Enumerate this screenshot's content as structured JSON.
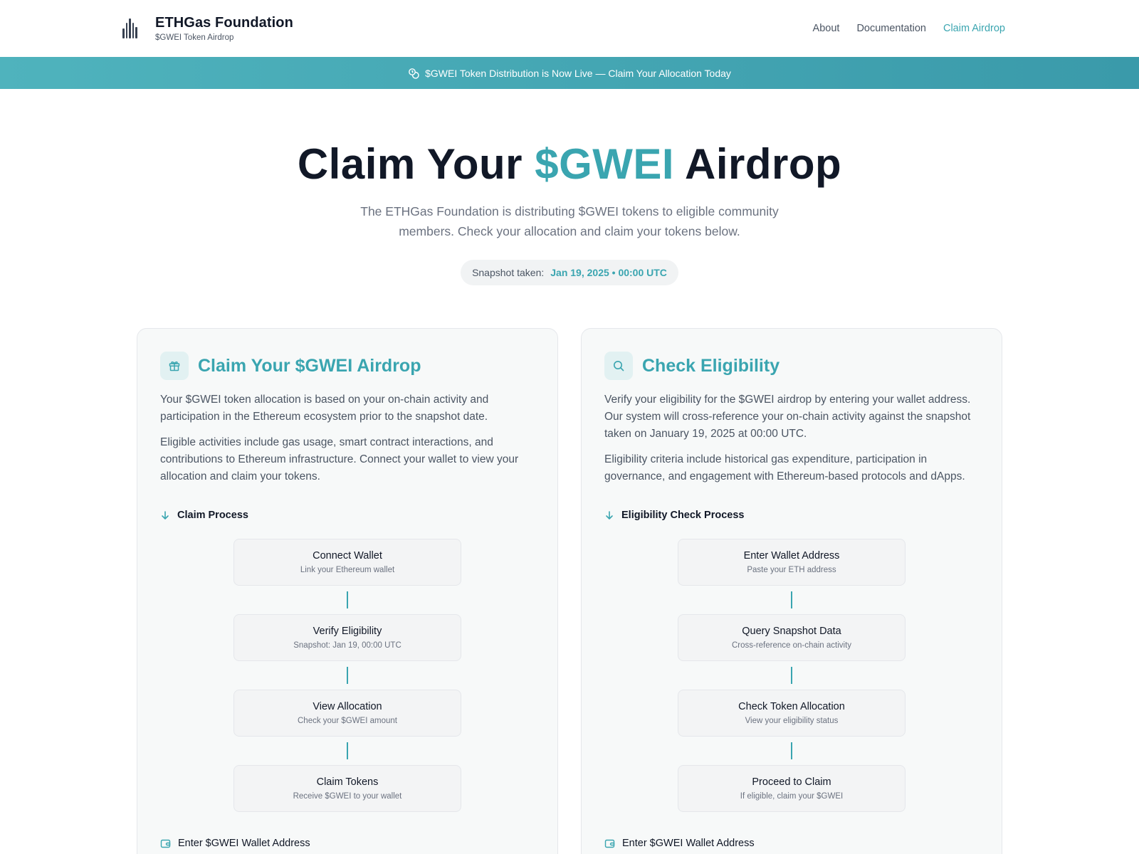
{
  "header": {
    "brand_title": "ETHGas Foundation",
    "brand_subtitle": "$GWEI Token Airdrop",
    "nav": [
      {
        "label": "About"
      },
      {
        "label": "Documentation"
      },
      {
        "label": "Claim Airdrop"
      }
    ]
  },
  "banner": {
    "text": "$GWEI Token Distribution is Now Live — Claim Your Allocation Today"
  },
  "hero": {
    "title_start": "Claim Your ",
    "title_accent": "$GWEI",
    "title_end": " Airdrop",
    "description": "The ETHGas Foundation is distributing $GWEI tokens to eligible community members. Check your allocation and claim your tokens below.",
    "snapshot_label": "Snapshot taken:",
    "snapshot_value": "Jan 19, 2025 • 00:00 UTC"
  },
  "claim_card": {
    "title": "Claim Your $GWEI Airdrop",
    "paragraph_1": "Your $GWEI token allocation is based on your on-chain activity and participation in the Ethereum ecosystem prior to the snapshot date.",
    "paragraph_2": "Eligible activities include gas usage, smart contract interactions, and contributions to Ethereum infrastructure. Connect your wallet to view your allocation and claim your tokens.",
    "process_label": "Claim Process",
    "steps": [
      {
        "title": "Connect Wallet",
        "subtitle": "Link your Ethereum wallet"
      },
      {
        "title": "Verify Eligibility",
        "subtitle": "Snapshot: Jan 19, 00:00 UTC"
      },
      {
        "title": "View Allocation",
        "subtitle": "Check your $GWEI amount"
      },
      {
        "title": "Claim Tokens",
        "subtitle": "Receive $GWEI to your wallet"
      }
    ],
    "wallet_label": "Enter $GWEI Wallet Address"
  },
  "eligibility_card": {
    "title": "Check Eligibility",
    "paragraph_1": "Verify your eligibility for the $GWEI airdrop by entering your wallet address. Our system will cross-reference your on-chain activity against the snapshot taken on January 19, 2025 at 00:00 UTC.",
    "paragraph_2": "Eligibility criteria include historical gas expenditure, participation in governance, and engagement with Ethereum-based protocols and dApps.",
    "process_label": "Eligibility Check Process",
    "steps": [
      {
        "title": "Enter Wallet Address",
        "subtitle": "Paste your ETH address"
      },
      {
        "title": "Query Snapshot Data",
        "subtitle": "Cross-reference on-chain activity"
      },
      {
        "title": "Check Token Allocation",
        "subtitle": "View your eligibility status"
      },
      {
        "title": "Proceed to Claim",
        "subtitle": "If eligible, claim your $GWEI"
      }
    ],
    "wallet_label": "Enter $GWEI Wallet Address"
  },
  "icons": {
    "logo": "bar-chart-logo-icon",
    "banner": "coins-icon",
    "claim_card": "gift-icon",
    "eligibility_card": "search-icon",
    "section": "arrow-down-icon",
    "wallet": "wallet-icon"
  },
  "colors": {
    "accent": "#3aa5b0",
    "banner_start": "#4fb3bd",
    "banner_end": "#3a9aaa",
    "heading": "#111827",
    "body_text": "#4b5563"
  }
}
